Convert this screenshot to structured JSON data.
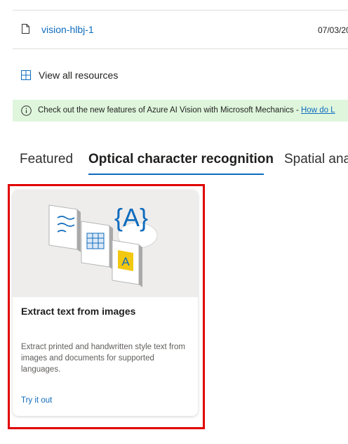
{
  "resource": {
    "name": "vision-hlbj-1",
    "date": "07/03/20",
    "icon": "file-icon"
  },
  "view_all": {
    "label": "View all resources",
    "icon": "grid-icon"
  },
  "banner": {
    "icon": "info-icon",
    "text": "Check out the new features of Azure AI Vision with Microsoft Mechanics - ",
    "link": "How do L",
    "color": "#dff6dd"
  },
  "tabs": [
    {
      "label": "Featured",
      "active": false
    },
    {
      "label": "Optical character recognition",
      "active": true
    },
    {
      "label": "Spatial ana",
      "active": false
    }
  ],
  "card": {
    "title": "Extract text from images",
    "description": "Extract printed and handwritten style text from images and documents for supported languages.",
    "link": "Try it out",
    "hero_glyph": "{A}",
    "badge_glyph": "A"
  },
  "colors": {
    "accent": "#0f6cbd",
    "highlight": "#e00000"
  }
}
